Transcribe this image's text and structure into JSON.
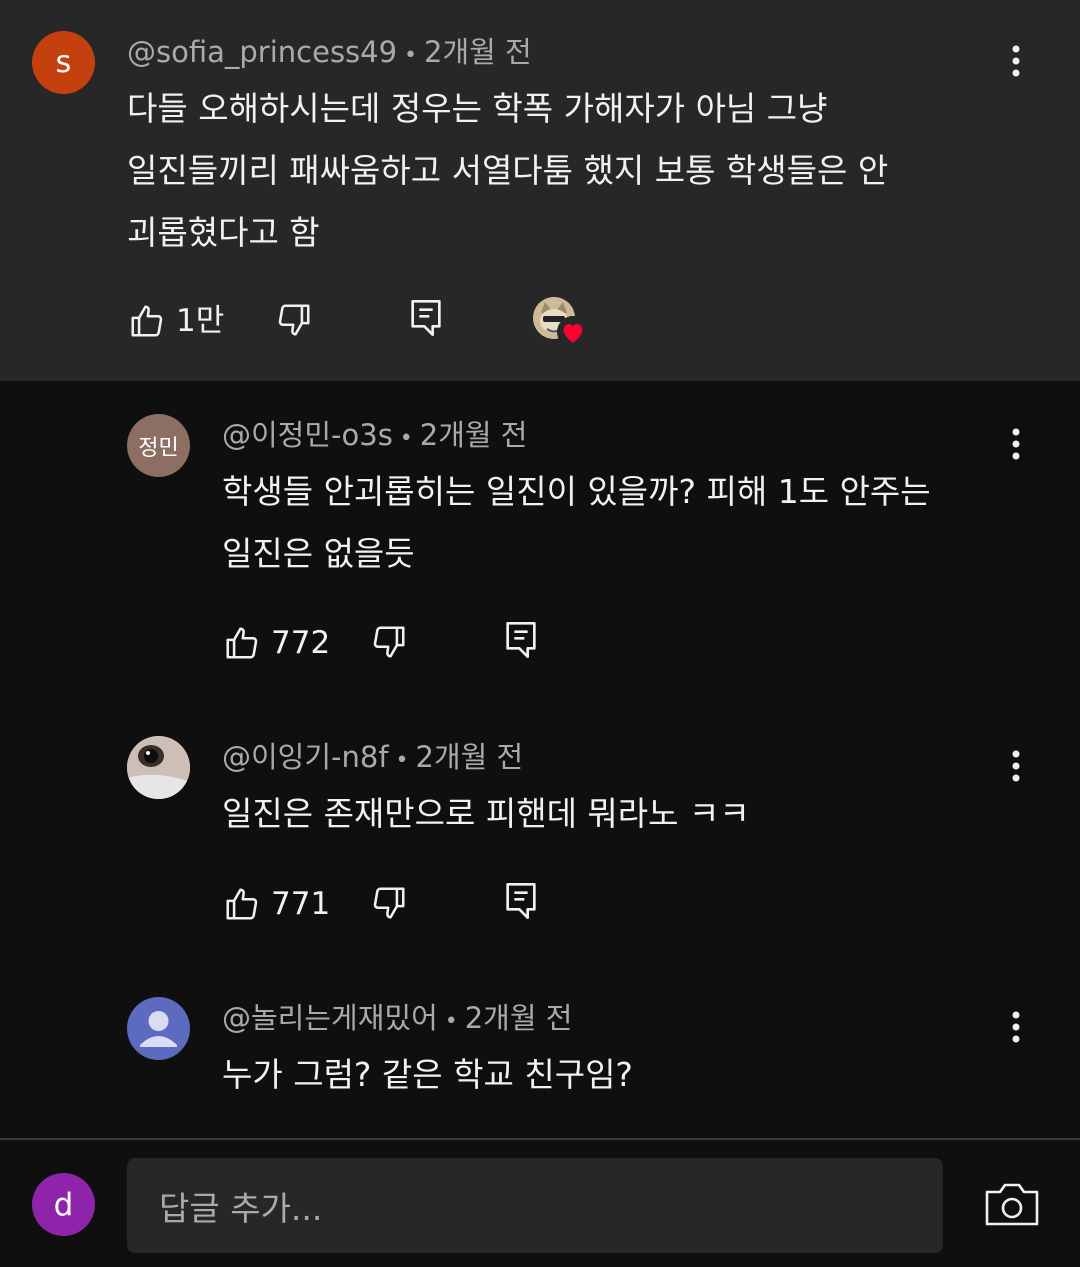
{
  "comments": [
    {
      "avatar_letter": "s",
      "avatar_color": "#c4410f",
      "handle": "@sofia_princess49",
      "sep": " • ",
      "time": "2개월 전",
      "lines": [
        "다들 오해하시는데 정우는 학폭 가해자가 아님 그냥",
        "일진들끼리 패싸움하고 서열다툼 했지 보통 학생들은 안",
        "괴롭혔다고 함"
      ],
      "like_count": "1만"
    },
    {
      "avatar_text": "정민",
      "avatar_color": "#8d6e63",
      "handle": "@이정민-o3s",
      "sep": " • ",
      "time": "2개월 전",
      "lines": [
        "학생들 안괴롭히는 일진이 있을까? 피해 1도 안주는",
        "일진은 없을듯"
      ],
      "like_count": "772"
    },
    {
      "handle": "@이잉기-n8f",
      "sep": " • ",
      "time": "2개월 전",
      "lines": [
        "일진은 존재만으로 피핸데 뭐라노 ㅋㅋ"
      ],
      "like_count": "771"
    },
    {
      "avatar_color": "#5c6bc0",
      "handle": "@놀리는게재밌어",
      "sep": " • ",
      "time": "2개월 전",
      "lines": [
        "누가 그럼? 같은 학교 친구임?"
      ]
    }
  ],
  "footer": {
    "user_avatar_letter": "d",
    "user_avatar_color": "#8e24aa",
    "reply_placeholder": "답글 추가..."
  },
  "colors": {
    "heart": "#ff0033"
  },
  "icons": [
    "like-icon",
    "dislike-icon",
    "reply-icon",
    "more-vertical-icon",
    "camera-icon",
    "creator-heart-icon"
  ]
}
